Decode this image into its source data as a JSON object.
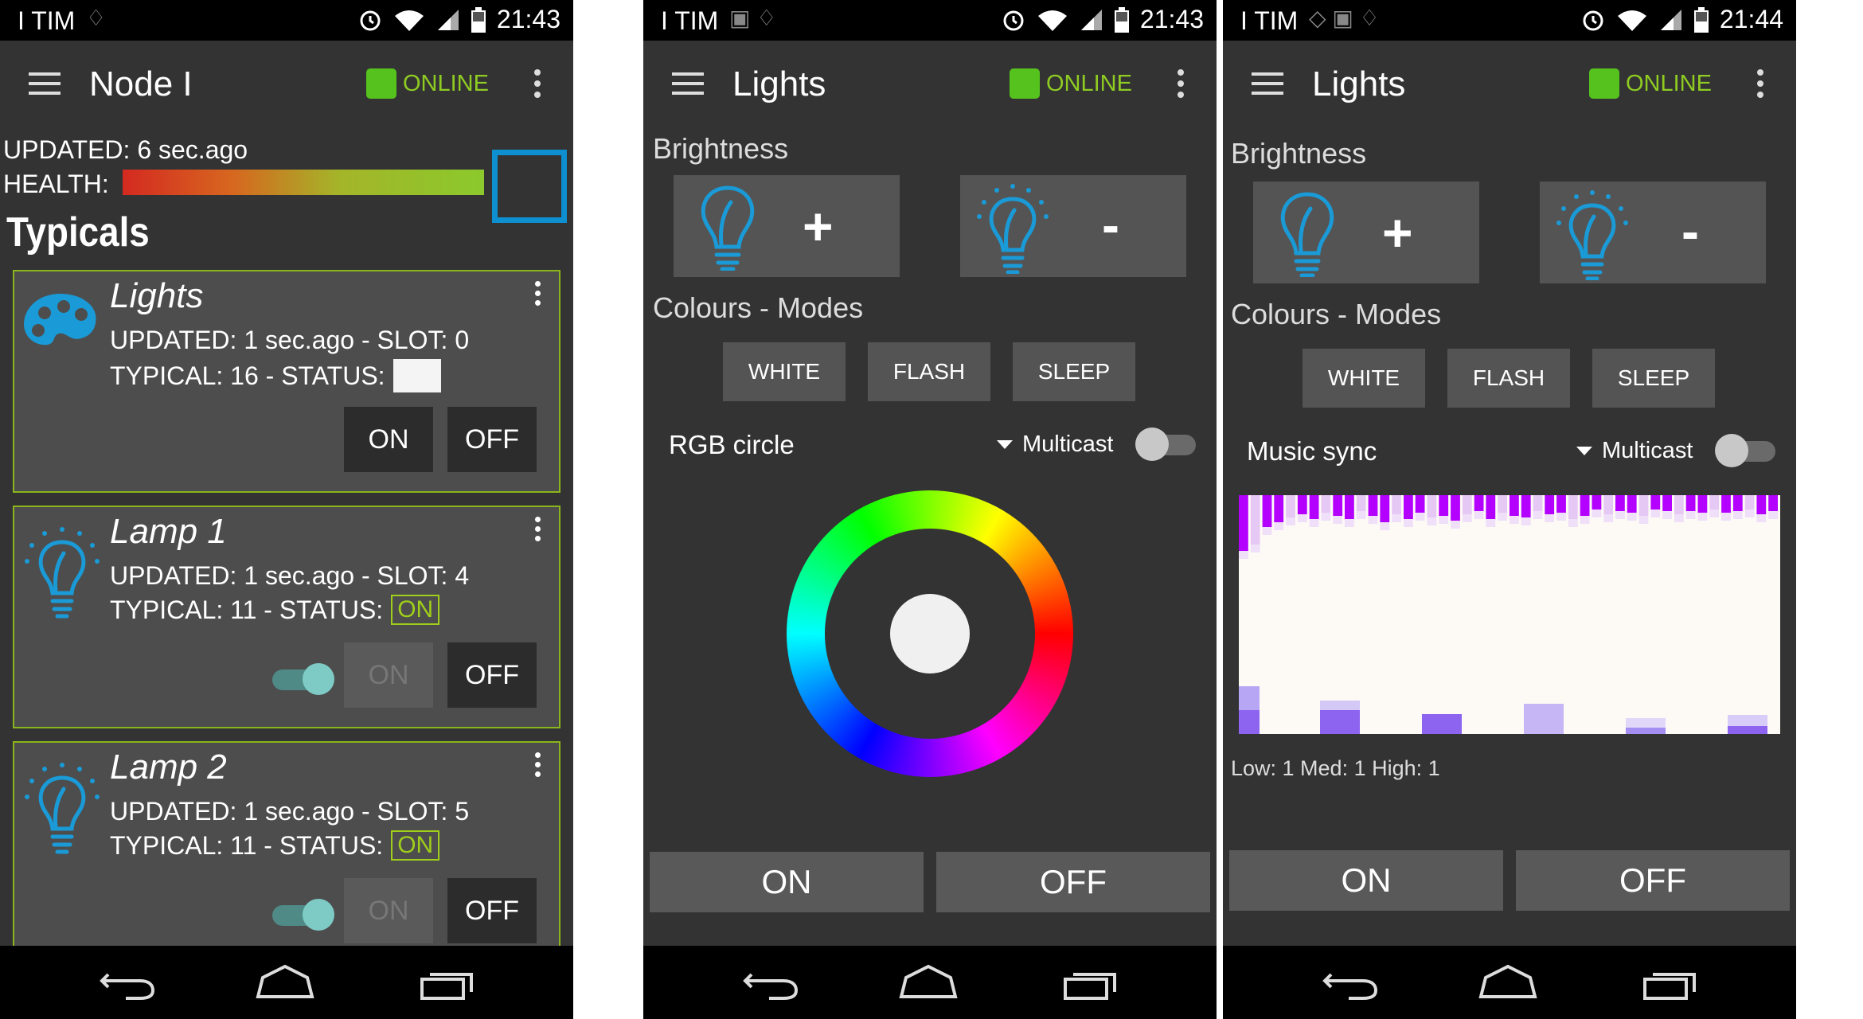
{
  "status_bar": [
    {
      "carrier": "I TIM",
      "time": "21:43"
    },
    {
      "carrier": "I TIM",
      "time": "21:43"
    },
    {
      "carrier": "I TIM",
      "time": "21:44"
    }
  ],
  "screen1": {
    "title": "Node I",
    "online_label": "ONLINE",
    "updated": "UPDATED: 6 sec.ago",
    "health_label": "HEALTH:",
    "section_title": "Typicals",
    "cards": [
      {
        "title": "Lights",
        "line1": "UPDATED: 1 sec.ago - SLOT: 0",
        "line2": "TYPICAL: 16 - STATUS:",
        "on": "ON",
        "off": "OFF"
      },
      {
        "title": "Lamp 1",
        "line1": "UPDATED: 1 sec.ago - SLOT: 4",
        "line2": "TYPICAL: 11 - STATUS:",
        "status": "ON",
        "on": "ON",
        "off": "OFF"
      },
      {
        "title": "Lamp 2",
        "line1": "UPDATED: 1 sec.ago - SLOT: 5",
        "line2": "TYPICAL: 11 - STATUS:",
        "status": "ON",
        "on": "ON",
        "off": "OFF"
      }
    ]
  },
  "screen2": {
    "title": "Lights",
    "online_label": "ONLINE",
    "brightness_label": "Brightness",
    "plus": "+",
    "minus": "-",
    "modes_label": "Colours - Modes",
    "modes": [
      "WHITE",
      "FLASH",
      "SLEEP"
    ],
    "section": "RGB circle",
    "multicast": "Multicast",
    "on": "ON",
    "off": "OFF"
  },
  "screen3": {
    "title": "Lights",
    "online_label": "ONLINE",
    "brightness_label": "Brightness",
    "plus": "+",
    "minus": "-",
    "modes_label": "Colours - Modes",
    "modes": [
      "WHITE",
      "FLASH",
      "SLEEP"
    ],
    "section": "Music sync",
    "multicast": "Multicast",
    "levels": "Low: 1 Med: 1 High: 1",
    "on": "ON",
    "off": "OFF"
  },
  "colors": {
    "background": "#333333",
    "accent_green": "#8fcc22",
    "online_dot": "#55c21e",
    "icon_blue": "#1a9ad6",
    "spectrum_purple": "#b400ff",
    "spectrum_violet": "#8c64f0"
  },
  "icons": [
    "menu-icon",
    "overflow-icon",
    "palette-icon",
    "bulb-icon",
    "back-icon",
    "home-icon",
    "recents-icon",
    "alarm-icon",
    "wifi-icon",
    "signal-icon",
    "battery-icon"
  ]
}
